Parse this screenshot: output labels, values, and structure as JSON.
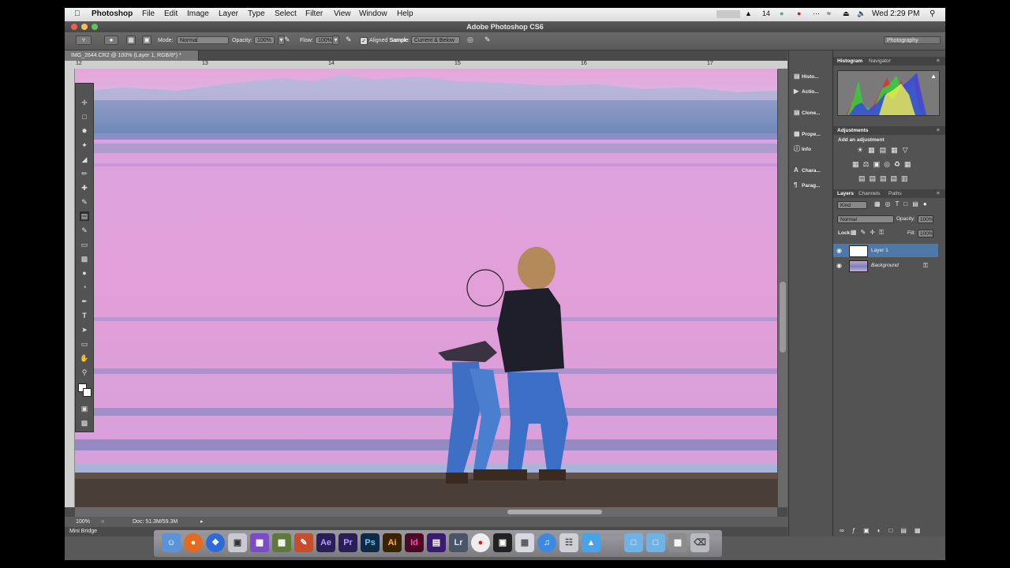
{
  "menubar": {
    "app_name": "Photoshop",
    "menus": [
      "File",
      "Edit",
      "Image",
      "Layer",
      "Type",
      "Select",
      "Filter",
      "View",
      "Window",
      "Help"
    ],
    "status_small": "14",
    "clock": "Wed 2:29 PM"
  },
  "window": {
    "title": "Adobe Photoshop CS6"
  },
  "options": {
    "mode_label": "Mode:",
    "mode_value": "Normal",
    "opacity_label": "Opacity:",
    "opacity_value": "100%",
    "flow_label": "Flow:",
    "flow_value": "100%",
    "aligned_label": "Aligned Sample",
    "sample_label": "Sample:",
    "sample_value": "Current & Below",
    "workspace": "Photography"
  },
  "document": {
    "tab_title": "IMG_2644.CR2 @ 100% (Layer 1, RGB/8*) *",
    "ruler_ticks": [
      "12",
      "13",
      "14",
      "15",
      "16",
      "17"
    ],
    "zoom": "100%",
    "doc_info": "Doc: 51.3M/59.3M"
  },
  "mini_bridge": "Mini Bridge",
  "collapsed_panels": [
    {
      "label": "Histo...",
      "icon": "history-icon"
    },
    {
      "label": "Actio...",
      "icon": "actions-icon"
    },
    {
      "label": "Clone...",
      "icon": "clone-source-icon"
    },
    {
      "label": "Prope...",
      "icon": "properties-icon"
    },
    {
      "label": "Info",
      "icon": "info-icon"
    },
    {
      "label": "Chara...",
      "icon": "character-icon"
    },
    {
      "label": "Parag...",
      "icon": "paragraph-icon"
    }
  ],
  "histogram_tabs": [
    "Histogram",
    "Navigator"
  ],
  "adjustments": {
    "tab": "Adjustments",
    "subtitle": "Add an adjustment"
  },
  "layers_panel": {
    "tabs": [
      "Layers",
      "Channels",
      "Paths"
    ],
    "filter": "Kind",
    "blend_mode": "Normal",
    "opacity_label": "Opacity:",
    "opacity_value": "100%",
    "lock_label": "Lock:",
    "fill_label": "Fill:",
    "fill_value": "100%",
    "layers": [
      "Layer 1",
      "Background"
    ]
  },
  "dock_apps": [
    "Finder",
    "Firefox",
    "Safari",
    "Preview",
    "Ae",
    "Pr",
    "Ps",
    "Ai",
    "Id",
    "Lr",
    "iTunes",
    "Trash"
  ],
  "colors": {
    "accent": "#4d78a8"
  }
}
